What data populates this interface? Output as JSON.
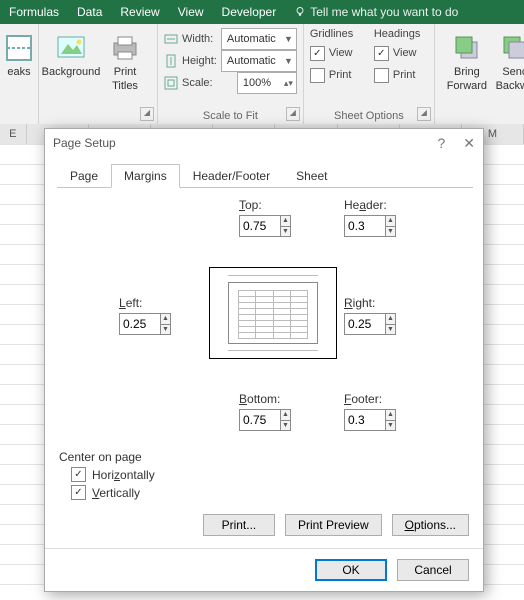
{
  "ribbon": {
    "tabs": [
      "Formulas",
      "Data",
      "Review",
      "View",
      "Developer"
    ],
    "tellme": "Tell me what you want to do",
    "breaks": "eaks",
    "background": "Background",
    "printTitles1": "Print",
    "printTitles2": "Titles",
    "width": "Width:",
    "height": "Height:",
    "scale": "Scale:",
    "auto": "Automatic",
    "scaleVal": "100%",
    "scaleGroup": "Scale to Fit",
    "gridlines": "Gridlines",
    "headings": "Headings",
    "view": "View",
    "print": "Print",
    "sheetOptions": "Sheet Options",
    "bring1": "Bring",
    "bring2": "Forward",
    "send1": "Senc",
    "send2": "Backwa"
  },
  "cols": [
    "E",
    "",
    "",
    "",
    "",
    "",
    "",
    "",
    "M"
  ],
  "dialog": {
    "title": "Page Setup",
    "tabs": [
      "Page",
      "Margins",
      "Header/Footer",
      "Sheet"
    ],
    "activeTab": 1,
    "top": "Top:",
    "header": "Header:",
    "left": "Left:",
    "right": "Right:",
    "bottom": "Bottom:",
    "footer": "Footer:",
    "vals": {
      "top": "0.75",
      "header": "0.3",
      "left": "0.25",
      "right": "0.25",
      "bottom": "0.75",
      "footer": "0.3"
    },
    "centerOn": "Center on page",
    "horiz": "Horizontally",
    "vert": "Vertically",
    "printBtn": "Print...",
    "previewBtn": "Print Preview",
    "optionsBtn": "Options...",
    "ok": "OK",
    "cancel": "Cancel"
  }
}
